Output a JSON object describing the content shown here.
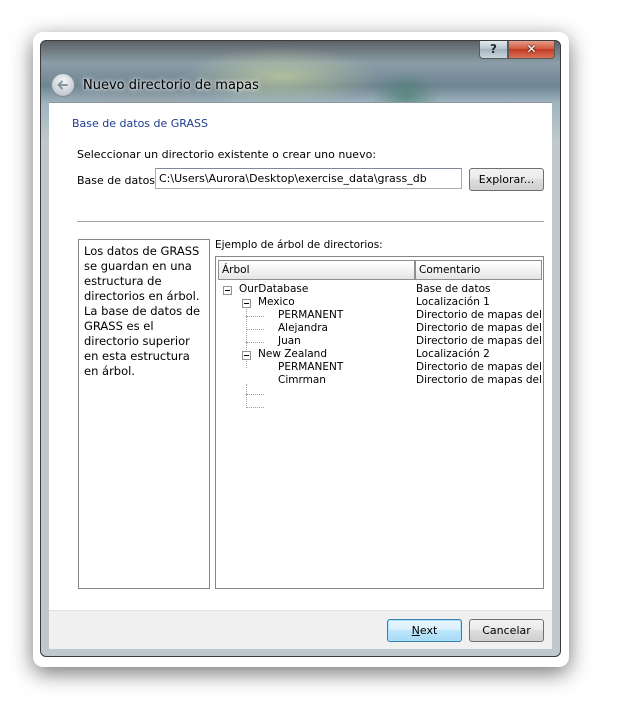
{
  "window": {
    "title": "Nuevo directorio de mapas",
    "help_label": "?",
    "close_label": "✕",
    "back_icon": "back-arrow-icon"
  },
  "page": {
    "section_title": "Base de datos de GRASS",
    "prompt": "Seleccionar un directorio existente o crear uno nuevo:",
    "db_label": "Base de datos:",
    "db_value": "C:\\Users\\Aurora\\Desktop\\exercise_data\\grass_db",
    "browse_label": "Explorar...",
    "description": "Los datos de GRASS se guardan en una estructura de directorios en árbol. La base de datos de GRASS es el directorio superior en esta estructura en árbol.",
    "tree_caption": "Ejemplo de árbol de directorios:",
    "columns": {
      "tree": "Árbol",
      "comment": "Comentario"
    },
    "rows": [
      {
        "name": "OurDatabase",
        "comment": "Base de datos"
      },
      {
        "name": "Mexico",
        "comment": "Localización 1"
      },
      {
        "name": "PERMANENT",
        "comment": "Directorio de mapas del..."
      },
      {
        "name": "Alejandra",
        "comment": "Directorio de mapas del..."
      },
      {
        "name": "Juan",
        "comment": "Directorio de mapas del..."
      },
      {
        "name": "New Zealand",
        "comment": "Localización 2"
      },
      {
        "name": "PERMANENT",
        "comment": "Directorio de mapas del..."
      },
      {
        "name": "Cimrman",
        "comment": "Directorio de mapas del..."
      }
    ]
  },
  "footer": {
    "next_first": "N",
    "next_rest": "ext",
    "cancel_label": "Cancelar"
  },
  "colors": {
    "section_title": "#1e3c8c",
    "close_button": "#c23a20"
  }
}
